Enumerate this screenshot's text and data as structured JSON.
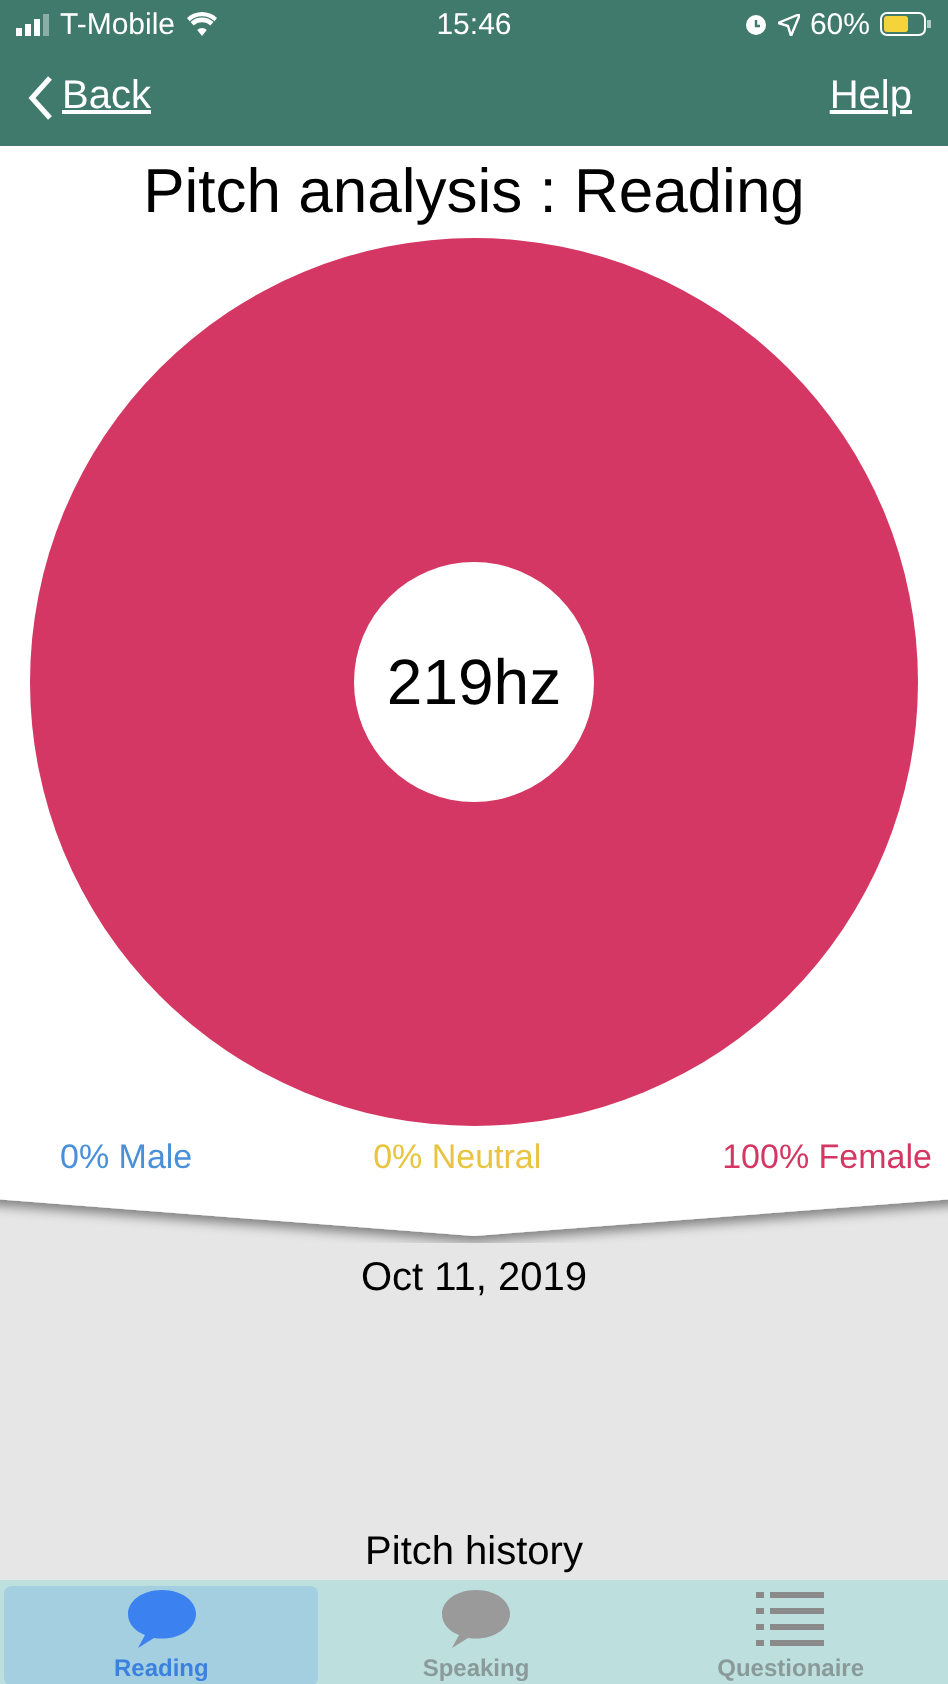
{
  "status_bar": {
    "carrier": "T-Mobile",
    "time": "15:46",
    "battery": "60%"
  },
  "nav": {
    "back": "Back",
    "help": "Help"
  },
  "title": "Pitch analysis : Reading",
  "chart": {
    "center_label": "219hz",
    "chart_data": {
      "type": "pie",
      "categories": [
        "0% Male",
        "0% Neutral",
        "100% Female"
      ],
      "values": [
        0,
        0,
        100
      ]
    }
  },
  "legend": [
    {
      "color": "#4a90d9"
    },
    {
      "color": "#e8c440"
    },
    {
      "color": "#d43763"
    }
  ],
  "history": {
    "date": "Oct 11, 2019",
    "heading": "Pitch history"
  },
  "tabs": [
    {
      "label": "Reading",
      "selected": true,
      "kind": "bubble"
    },
    {
      "label": "Speaking",
      "selected": false,
      "kind": "bubble"
    },
    {
      "label": "Questionaire",
      "selected": false,
      "kind": "list"
    }
  ]
}
